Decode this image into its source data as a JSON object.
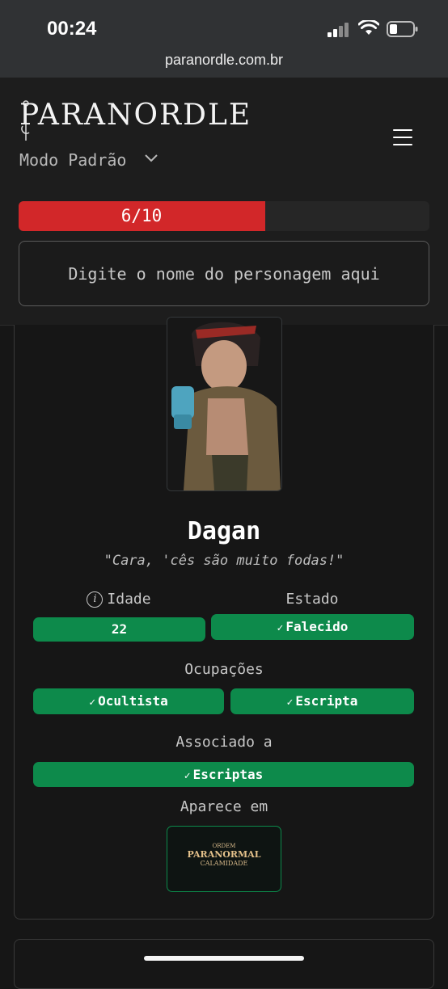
{
  "status_bar": {
    "time": "00:24"
  },
  "browser": {
    "url": "paranordle.com.br"
  },
  "header": {
    "logo_text": "PARANORDLE",
    "mode_label": "Modo Padrão"
  },
  "progress": {
    "label": "6/10",
    "fraction": 0.6,
    "color": "#d22729"
  },
  "search": {
    "placeholder": "Digite o nome do personagem aqui",
    "value": ""
  },
  "character": {
    "name": "Dagan",
    "quote": "\"Cara, 'cês são muito fodas!\"",
    "age_label": "Idade",
    "age_value": "22",
    "state_label": "Estado",
    "state_value": "Falecido",
    "occupations_label": "Ocupações",
    "occupations": [
      "Ocultista",
      "Escripta"
    ],
    "associated_label": "Associado a",
    "associated": "Escriptas",
    "appears_label": "Aparece em",
    "appears_game_line1": "ORDEM",
    "appears_game_line2": "PARANORMAL",
    "appears_game_line3": "CALAMIDADE"
  },
  "colors": {
    "accent_green": "#0d8a4b",
    "accent_red": "#d22729",
    "background": "#161616"
  }
}
